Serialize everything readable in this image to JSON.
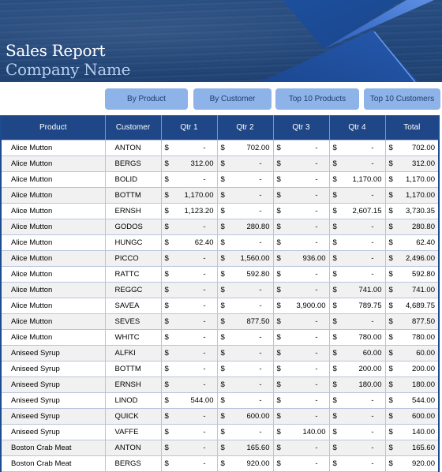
{
  "header": {
    "title": "Sales Report",
    "subtitle": "Company Name"
  },
  "nav": {
    "buttons": [
      {
        "label": "By Product"
      },
      {
        "label": "By Customer"
      },
      {
        "label": "Top 10 Products"
      },
      {
        "label": "Top 10 Customers"
      }
    ]
  },
  "colors": {
    "header_bg": "#1f4787",
    "button_bg": "#8db3e8",
    "banner_bg": "#1f4478",
    "subtitle": "#b4cdec",
    "alt_row": "#f1f1f1"
  },
  "table": {
    "currency_symbol": "$",
    "columns": [
      "Product",
      "Customer",
      "Qtr 1",
      "Qtr 2",
      "Qtr 3",
      "Qtr 4",
      "Total"
    ],
    "rows": [
      {
        "product": "Alice Mutton",
        "customer": "ANTON",
        "q1": "-",
        "q2": "702.00",
        "q3": "-",
        "q4": "-",
        "total": "702.00"
      },
      {
        "product": "Alice Mutton",
        "customer": "BERGS",
        "q1": "312.00",
        "q2": "-",
        "q3": "-",
        "q4": "-",
        "total": "312.00"
      },
      {
        "product": "Alice Mutton",
        "customer": "BOLID",
        "q1": "-",
        "q2": "-",
        "q3": "-",
        "q4": "1,170.00",
        "total": "1,170.00"
      },
      {
        "product": "Alice Mutton",
        "customer": "BOTTM",
        "q1": "1,170.00",
        "q2": "-",
        "q3": "-",
        "q4": "-",
        "total": "1,170.00"
      },
      {
        "product": "Alice Mutton",
        "customer": "ERNSH",
        "q1": "1,123.20",
        "q2": "-",
        "q3": "-",
        "q4": "2,607.15",
        "total": "3,730.35"
      },
      {
        "product": "Alice Mutton",
        "customer": "GODOS",
        "q1": "-",
        "q2": "280.80",
        "q3": "-",
        "q4": "-",
        "total": "280.80"
      },
      {
        "product": "Alice Mutton",
        "customer": "HUNGC",
        "q1": "62.40",
        "q2": "-",
        "q3": "-",
        "q4": "-",
        "total": "62.40"
      },
      {
        "product": "Alice Mutton",
        "customer": "PICCO",
        "q1": "-",
        "q2": "1,560.00",
        "q3": "936.00",
        "q4": "-",
        "total": "2,496.00"
      },
      {
        "product": "Alice Mutton",
        "customer": "RATTC",
        "q1": "-",
        "q2": "592.80",
        "q3": "-",
        "q4": "-",
        "total": "592.80"
      },
      {
        "product": "Alice Mutton",
        "customer": "REGGC",
        "q1": "-",
        "q2": "-",
        "q3": "-",
        "q4": "741.00",
        "total": "741.00"
      },
      {
        "product": "Alice Mutton",
        "customer": "SAVEA",
        "q1": "-",
        "q2": "-",
        "q3": "3,900.00",
        "q4": "789.75",
        "total": "4,689.75"
      },
      {
        "product": "Alice Mutton",
        "customer": "SEVES",
        "q1": "-",
        "q2": "877.50",
        "q3": "-",
        "q4": "-",
        "total": "877.50"
      },
      {
        "product": "Alice Mutton",
        "customer": "WHITC",
        "q1": "-",
        "q2": "-",
        "q3": "-",
        "q4": "780.00",
        "total": "780.00"
      },
      {
        "product": "Aniseed Syrup",
        "customer": "ALFKI",
        "q1": "-",
        "q2": "-",
        "q3": "-",
        "q4": "60.00",
        "total": "60.00"
      },
      {
        "product": "Aniseed Syrup",
        "customer": "BOTTM",
        "q1": "-",
        "q2": "-",
        "q3": "-",
        "q4": "200.00",
        "total": "200.00"
      },
      {
        "product": "Aniseed Syrup",
        "customer": "ERNSH",
        "q1": "-",
        "q2": "-",
        "q3": "-",
        "q4": "180.00",
        "total": "180.00"
      },
      {
        "product": "Aniseed Syrup",
        "customer": "LINOD",
        "q1": "544.00",
        "q2": "-",
        "q3": "-",
        "q4": "-",
        "total": "544.00"
      },
      {
        "product": "Aniseed Syrup",
        "customer": "QUICK",
        "q1": "-",
        "q2": "600.00",
        "q3": "-",
        "q4": "-",
        "total": "600.00"
      },
      {
        "product": "Aniseed Syrup",
        "customer": "VAFFE",
        "q1": "-",
        "q2": "-",
        "q3": "140.00",
        "q4": "-",
        "total": "140.00"
      },
      {
        "product": "Boston Crab Meat",
        "customer": "ANTON",
        "q1": "-",
        "q2": "165.60",
        "q3": "-",
        "q4": "-",
        "total": "165.60"
      },
      {
        "product": "Boston Crab Meat",
        "customer": "BERGS",
        "q1": "-",
        "q2": "920.00",
        "q3": "-",
        "q4": "-",
        "total": "920.00"
      }
    ]
  }
}
